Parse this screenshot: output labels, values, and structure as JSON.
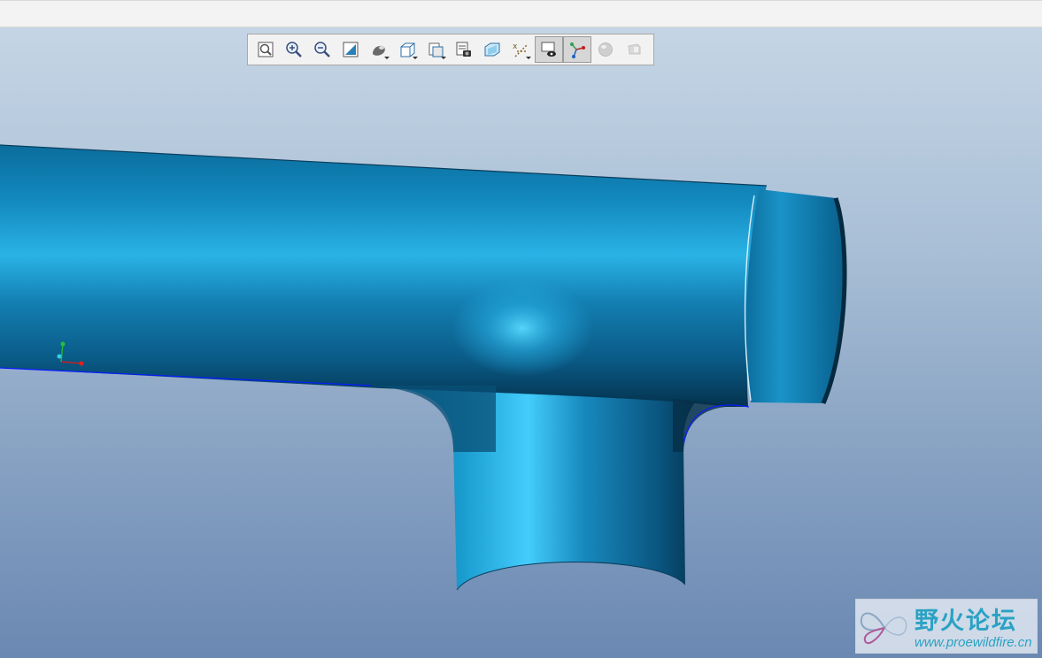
{
  "window": {
    "title_bar_text": ""
  },
  "view_toolbar": {
    "tools": [
      {
        "id": "refit",
        "icon": "refit-zoom-icon",
        "active": false,
        "has_dropdown": false
      },
      {
        "id": "zoom_in",
        "icon": "zoom-in-icon",
        "active": false,
        "has_dropdown": false
      },
      {
        "id": "zoom_out",
        "icon": "zoom-out-icon",
        "active": false,
        "has_dropdown": false
      },
      {
        "id": "repaint",
        "icon": "repaint-icon",
        "active": false,
        "has_dropdown": false
      },
      {
        "id": "display_style",
        "icon": "display-style-icon",
        "active": false,
        "has_dropdown": true
      },
      {
        "id": "saved_orientations",
        "icon": "saved-orientations-icon",
        "active": false,
        "has_dropdown": true
      },
      {
        "id": "view_manager",
        "icon": "view-manager-icon",
        "active": false,
        "has_dropdown": true
      },
      {
        "id": "perspective",
        "icon": "perspective-icon",
        "active": false,
        "has_dropdown": false
      },
      {
        "id": "section",
        "icon": "section-icon",
        "active": false,
        "has_dropdown": false
      },
      {
        "id": "datum_display",
        "icon": "datum-display-icon",
        "active": false,
        "has_dropdown": true
      },
      {
        "id": "annotation_display",
        "icon": "annotation-display-icon",
        "active": true,
        "has_dropdown": false
      },
      {
        "id": "spin_center",
        "icon": "spin-center-icon",
        "active": true,
        "has_dropdown": false
      },
      {
        "id": "appearance",
        "icon": "appearance-sphere-icon",
        "active": false,
        "has_dropdown": false
      },
      {
        "id": "disabled_tool",
        "icon": "disabled-tool-icon",
        "active": false,
        "has_dropdown": false
      }
    ]
  },
  "colors": {
    "model": "#1580b0",
    "model_highlight": "#4fd4ff",
    "model_shadow": "#052f47",
    "background_top": "#c5d5e5",
    "background_bottom": "#6a88b2",
    "edge_highlight": "#0a1cff"
  },
  "watermark": {
    "title": "野火论坛",
    "url": "www.proewildfire.cn"
  }
}
